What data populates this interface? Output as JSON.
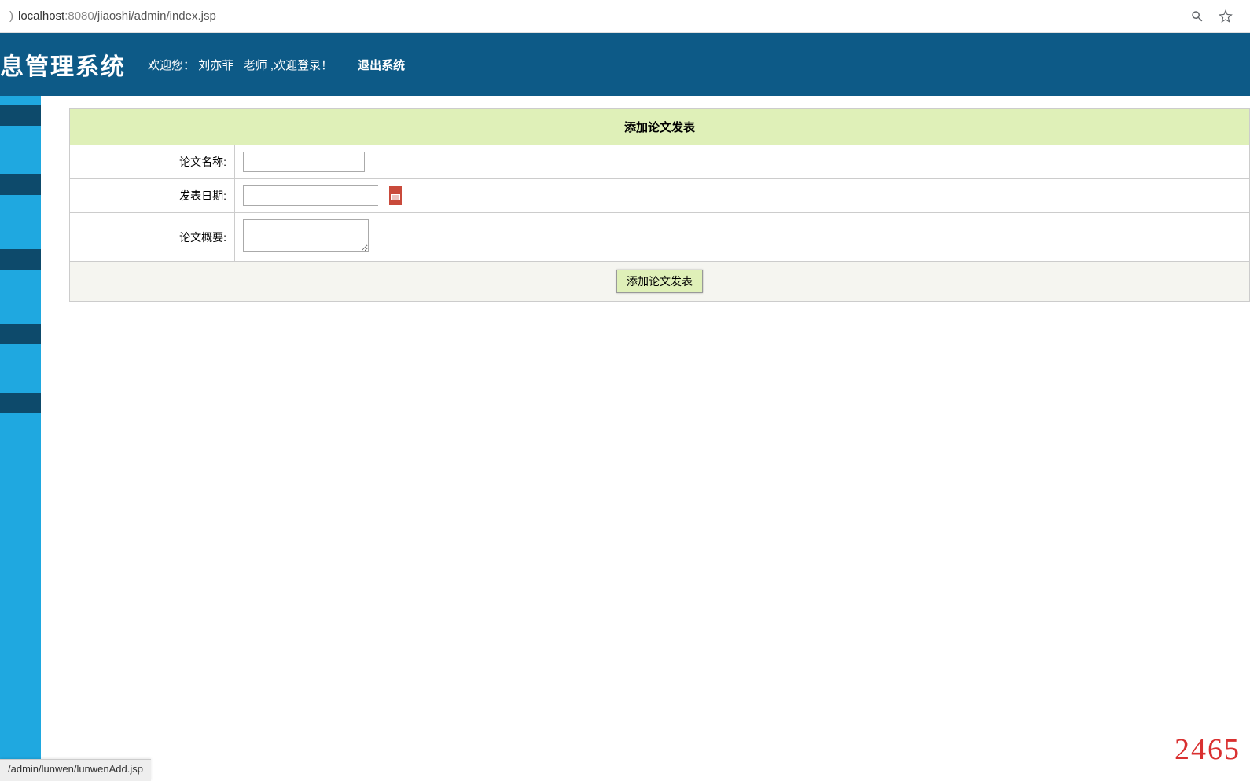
{
  "browser": {
    "url_host": "localhost",
    "url_port": ":8080",
    "url_path": "/jiaoshi/admin/index.jsp"
  },
  "header": {
    "title": "息管理系统",
    "welcome_prefix": "欢迎您：",
    "username": "刘亦菲",
    "role": "老师",
    "welcome_suffix": " ,欢迎登录！",
    "logout": "退出系统"
  },
  "form": {
    "title": "添加论文发表",
    "fields": {
      "name_label": "论文名称:",
      "date_label": "发表日期:",
      "summary_label": "论文概要:"
    },
    "submit_label": "添加论文发表"
  },
  "status_bar": {
    "text": "/admin/lunwen/lunwenAdd.jsp"
  },
  "watermark": "2465"
}
